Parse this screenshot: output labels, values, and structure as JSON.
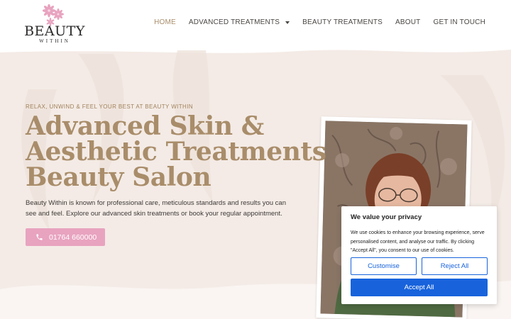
{
  "brand": {
    "name_main": "BEAUTY",
    "name_sub": "WITHIN",
    "flower_color": "#e8a3bf"
  },
  "nav": {
    "items": [
      {
        "label": "HOME",
        "active": true
      },
      {
        "label": "ADVANCED TREATMENTS",
        "has_dropdown": true
      },
      {
        "label": "BEAUTY TREATMENTS"
      },
      {
        "label": "ABOUT"
      },
      {
        "label": "GET IN TOUCH"
      }
    ]
  },
  "hero": {
    "eyebrow": "RELAX, UNWIND & FEEL YOUR BEST AT BEAUTY WITHIN",
    "headline_lines": [
      "Advanced Skin &",
      "Aesthetic Treatments",
      "Beauty Salon"
    ],
    "intro": "Beauty Within is known for professional care, meticulous standards and results you can see and feel. Explore our advanced skin treatments or book your regular appointment.",
    "phone_label": "01764 660000",
    "accent_color": "#a98d6a",
    "button_color": "#e8a3bf",
    "background_color": "#f4ebe6"
  },
  "cookie": {
    "title": "We value your privacy",
    "text": "We use cookies to enhance your browsing experience, serve personalised content, and analyse our traffic. By clicking \"Accept All\", you consent to our use of cookies.",
    "customise_label": "Customise",
    "reject_label": "Reject All",
    "accept_label": "Accept All",
    "primary_color": "#1863dc"
  },
  "icons": {
    "phone": "phone-icon",
    "dropdown": "chevron-down-icon",
    "logo_flowers": "flower-icon"
  }
}
